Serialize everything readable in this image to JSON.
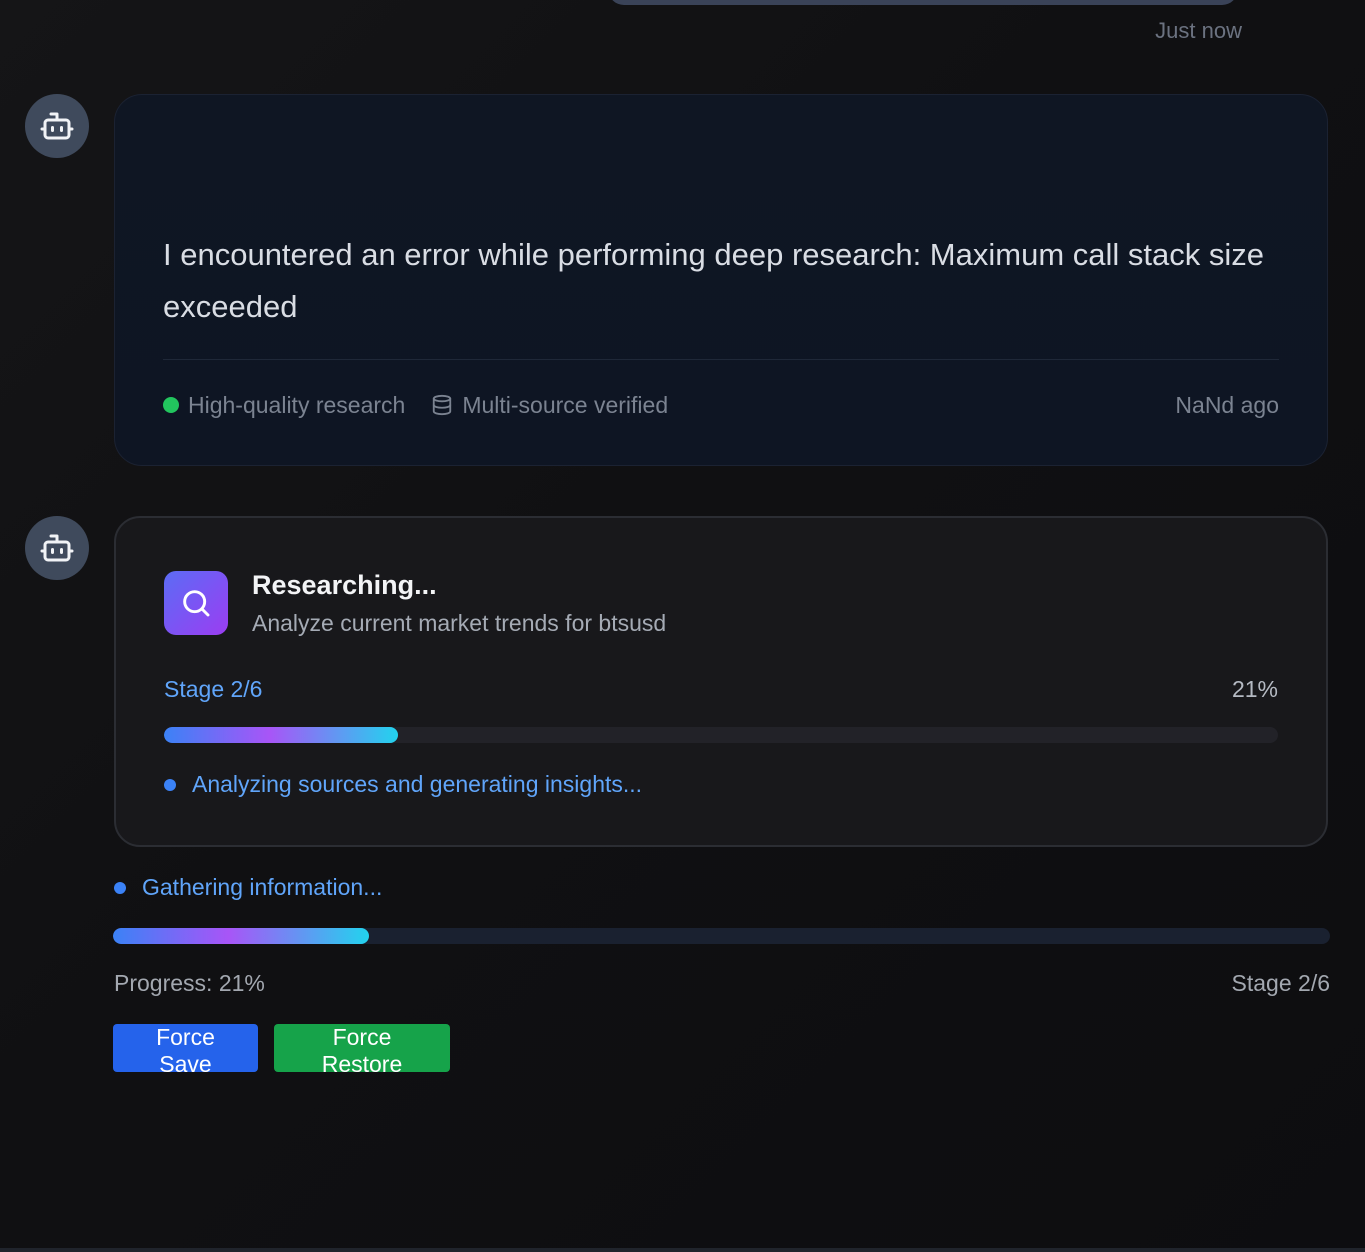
{
  "previous_message": {
    "timestamp": "Just now"
  },
  "error_message": {
    "avatar_icon": "robot-icon",
    "text": "I encountered an error while performing deep research: Maximum call stack size exceeded",
    "badges": {
      "quality": "High-quality research",
      "verified": "Multi-source verified"
    },
    "time_ago": "NaNd ago",
    "colors": {
      "quality_dot": "#22c55e"
    }
  },
  "research_card": {
    "avatar_icon": "robot-icon",
    "icon": "search-icon",
    "title": "Researching...",
    "subtitle": "Analyze current market trends for btsusd",
    "stage": "Stage 2/6",
    "percent": "21%",
    "progress_fraction": 0.21,
    "status": "Analyzing sources and generating insights..."
  },
  "outer_progress": {
    "status": "Gathering information...",
    "progress_fraction": 0.21,
    "progress_label": "Progress: 21%",
    "stage_label": "Stage 2/6"
  },
  "actions": {
    "force_save": "Force Save",
    "force_restore": "Force Restore",
    "colors": {
      "save": "#2563eb",
      "restore": "#16a34a"
    }
  }
}
